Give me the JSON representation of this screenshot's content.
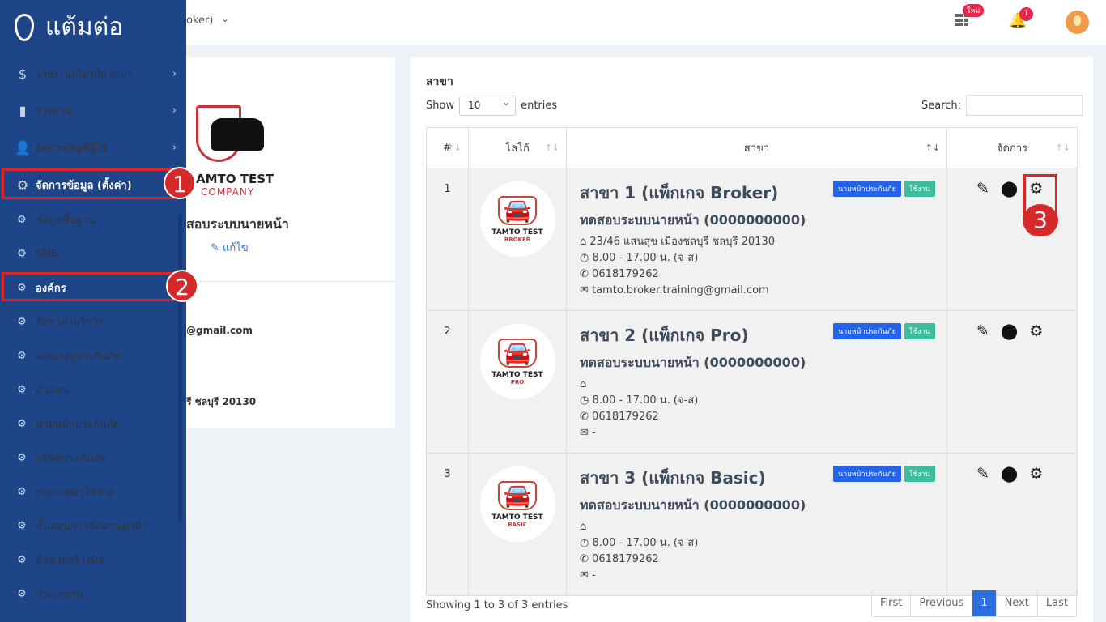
{
  "topbar": {
    "breadcrumb": "oker)",
    "new_badge": "ใหม่",
    "notification_count": "1"
  },
  "sidebar": {
    "logo": "แต้มต่อ",
    "items": [
      {
        "label": "รายงานเกี่ยวกับ คปภ.",
        "icon": "dollar-report-icon"
      },
      {
        "label": "รายงาน",
        "icon": "bar-chart-icon"
      },
      {
        "label": "จัดการบัญชีผู้ใช้",
        "icon": "user-plus-icon"
      },
      {
        "label": "จัดการข้อมูล (ตั้งค่า)",
        "icon": "gears-icon"
      }
    ],
    "subitems": [
      "ข้อมูลพื้นฐาน",
      "SMS",
      "องค์กร",
      "อัตราค่าบริการ",
      "แคมเปญประกันภัย",
      "ตัวแทน",
      "นายหน้าประกันภัย",
      "บริษัทประกันภัย",
      "ประเภทค่าใช้จ่าย",
      "ขั้นตอนการติดตามลูกค้า",
      "ตัวช่วยสร้างบิล",
      "ประเภทรถ"
    ]
  },
  "steps": [
    "1",
    "2",
    "3"
  ],
  "org": {
    "logo_line1": "AMTO TEST",
    "logo_line2": "COMPANY",
    "name": "สอบระบบนายหน้า",
    "edit": "แก้ไข",
    "email": "@gmail.com",
    "address": "รี ชลบุรี 20130"
  },
  "branches": {
    "title": "สาขา",
    "show": "Show",
    "entries_value": "10",
    "entries": "entries",
    "search_label": "Search:",
    "search_value": "",
    "columns": [
      "#",
      "โลโก้",
      "สาขา",
      "จัดการ"
    ],
    "rows": [
      {
        "num": "1",
        "logo1": "TAMTO TEST",
        "logo2": "BROKER",
        "name": "สาขา 1 (แพ็กเกจ Broker)",
        "sub": "ทดสอบระบบนายหน้า (0000000000)",
        "tag1": "นายหน้าประกันภัย",
        "tag2": "ใช้งาน",
        "address": "23/46 แสนสุข เมืองชลบุรี ชลบุรี 20130",
        "hours": "8.00 - 17.00 น. (จ-ส)",
        "phone": "0618179262",
        "email": "tamto.broker.training@gmail.com"
      },
      {
        "num": "2",
        "logo1": "TAMTO TEST",
        "logo2": "PRO",
        "name": "สาขา 2 (แพ็กเกจ Pro)",
        "sub": "ทดสอบระบบนายหน้า (0000000000)",
        "tag1": "นายหน้าประกันภัย",
        "tag2": "ใช้งาน",
        "address": "",
        "hours": "8.00 - 17.00 น. (จ-ส)",
        "phone": "0618179262",
        "email": "-"
      },
      {
        "num": "3",
        "logo1": "TAMTO TEST",
        "logo2": "BASIC",
        "name": "สาขา 3 (แพ็กเกจ Basic)",
        "sub": "ทดสอบระบบนายหน้า (0000000000)",
        "tag1": "นายหน้าประกันภัย",
        "tag2": "ใช้งาน",
        "address": "",
        "hours": "8.00 - 17.00 น. (จ-ส)",
        "phone": "0618179262",
        "email": "-"
      }
    ],
    "footer": "Showing 1 to 3 of 3 entries",
    "pager": [
      "First",
      "Previous",
      "1",
      "Next",
      "Last"
    ]
  },
  "colors": {
    "sidebar": "#1f4589",
    "accent": "#2d6ee0",
    "tag_blue": "#2563eb",
    "tag_green": "#3cbf9a",
    "highlight": "#e02424"
  }
}
